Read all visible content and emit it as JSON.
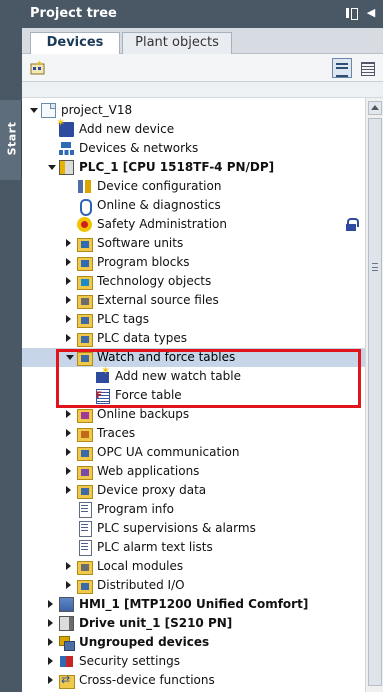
{
  "sidebar": {
    "start_label": "Start"
  },
  "panel": {
    "title": "Project tree",
    "pin_icon": "pin-icon",
    "collapse_icon": "collapse-icon"
  },
  "tabs": [
    {
      "label": "Devices",
      "active": true
    },
    {
      "label": "Plant objects",
      "active": false
    }
  ],
  "toolbar": {
    "new_icon": "add-group-icon",
    "view_icon": "details-view-icon",
    "list_icon": "list-icon"
  },
  "tree": {
    "items": [
      {
        "label": "project_V18",
        "icon": "project-icon",
        "expand": "down",
        "bold": false
      },
      {
        "label": "Add new device",
        "icon": "add-device-icon",
        "expand": "none",
        "bold": false
      },
      {
        "label": "Devices & networks",
        "icon": "network-icon",
        "expand": "none",
        "bold": false
      },
      {
        "label": "PLC_1 [CPU 1518TF-4 PN/DP]",
        "icon": "plc-icon",
        "expand": "down",
        "bold": true
      },
      {
        "label": "Device configuration",
        "icon": "device-config-icon",
        "expand": "none",
        "bold": false
      },
      {
        "label": "Online & diagnostics",
        "icon": "diagnostics-icon",
        "expand": "none",
        "bold": false
      },
      {
        "label": "Safety Administration",
        "icon": "safety-icon",
        "expand": "none",
        "bold": false,
        "lock": true
      },
      {
        "label": "Software units",
        "icon": "folder-icon",
        "expand": "right",
        "bold": false
      },
      {
        "label": "Program blocks",
        "icon": "folder-icon",
        "expand": "right",
        "bold": false
      },
      {
        "label": "Technology objects",
        "icon": "folder-icon",
        "expand": "right",
        "bold": false
      },
      {
        "label": "External source files",
        "icon": "folder-icon",
        "expand": "right",
        "bold": false
      },
      {
        "label": "PLC tags",
        "icon": "folder-icon",
        "expand": "right",
        "bold": false
      },
      {
        "label": "PLC data types",
        "icon": "folder-icon",
        "expand": "right",
        "bold": false
      },
      {
        "label": "Watch and force tables",
        "icon": "folder-icon",
        "expand": "down",
        "bold": false,
        "selected": true
      },
      {
        "label": "Add new watch table",
        "icon": "add-watch-table-icon",
        "expand": "none",
        "bold": false
      },
      {
        "label": "Force table",
        "icon": "force-table-icon",
        "expand": "none",
        "bold": false
      },
      {
        "label": "Online backups",
        "icon": "folder-icon",
        "expand": "right",
        "bold": false
      },
      {
        "label": "Traces",
        "icon": "folder-icon",
        "expand": "right",
        "bold": false
      },
      {
        "label": "OPC UA communication",
        "icon": "folder-icon",
        "expand": "right",
        "bold": false
      },
      {
        "label": "Web applications",
        "icon": "folder-icon",
        "expand": "right",
        "bold": false
      },
      {
        "label": "Device proxy data",
        "icon": "folder-icon",
        "expand": "right",
        "bold": false
      },
      {
        "label": "Program info",
        "icon": "document-icon",
        "expand": "none",
        "bold": false
      },
      {
        "label": "PLC supervisions & alarms",
        "icon": "document-icon",
        "expand": "none",
        "bold": false
      },
      {
        "label": "PLC alarm text lists",
        "icon": "document-icon",
        "expand": "none",
        "bold": false
      },
      {
        "label": "Local modules",
        "icon": "folder-icon",
        "expand": "right",
        "bold": false
      },
      {
        "label": "Distributed I/O",
        "icon": "folder-icon",
        "expand": "right",
        "bold": false
      },
      {
        "label": "HMI_1 [MTP1200 Unified Comfort]",
        "icon": "hmi-icon",
        "expand": "right",
        "bold": true
      },
      {
        "label": "Drive unit_1 [S210 PN]",
        "icon": "drive-icon",
        "expand": "right",
        "bold": true
      },
      {
        "label": "Ungrouped devices",
        "icon": "ungrouped-devices-icon",
        "expand": "right",
        "bold": true
      },
      {
        "label": "Security settings",
        "icon": "security-icon",
        "expand": "right",
        "bold": false
      },
      {
        "label": "Cross-device functions",
        "icon": "cross-device-icon",
        "expand": "right",
        "bold": false
      }
    ]
  },
  "colors": {
    "header_bg": "#4a5866",
    "selection_bg": "#c6d6e8",
    "highlight_border": "#e1141b"
  }
}
